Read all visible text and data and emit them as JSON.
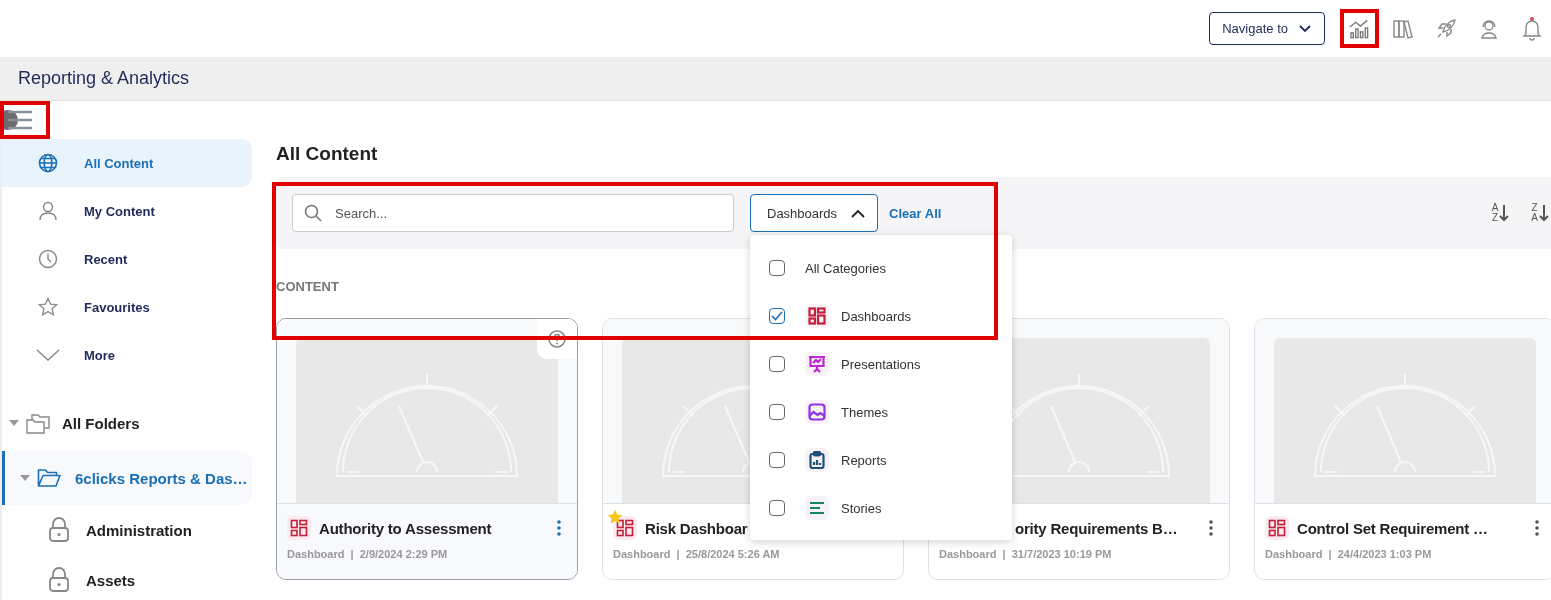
{
  "header": {
    "navigate_button": "Navigate to",
    "icons": [
      {
        "kind": "analytics",
        "selected": true
      },
      {
        "kind": "library",
        "selected": false
      },
      {
        "kind": "rocket",
        "selected": false
      },
      {
        "kind": "support",
        "selected": false
      },
      {
        "kind": "bell",
        "selected": false
      }
    ]
  },
  "page_title": "Reporting & Analytics",
  "sidebar": {
    "items": [
      {
        "label": "All Content",
        "kind": "globe",
        "selected": true
      },
      {
        "label": "My Content",
        "kind": "person",
        "selected": false
      },
      {
        "label": "Recent",
        "kind": "clock",
        "selected": false
      },
      {
        "label": "Favourites",
        "kind": "star",
        "selected": false
      },
      {
        "label": "More",
        "kind": "chevron",
        "selected": false
      }
    ],
    "folders": {
      "label": "All Folders",
      "expanded": true,
      "children": [
        {
          "label": "6clicks Reports & Das…",
          "expanded": true,
          "selected": true,
          "children": [
            {
              "label": "Administration"
            },
            {
              "label": "Assets"
            }
          ]
        }
      ]
    }
  },
  "main": {
    "heading": "All Content",
    "search": {
      "placeholder": "Search..."
    },
    "filter": {
      "label": "Dashboards",
      "open": true
    },
    "clear_all": "Clear All",
    "sort_buttons": [
      {
        "top": "A",
        "bottom": "Z"
      },
      {
        "top": "Z",
        "bottom": "A"
      }
    ],
    "section_label": "CONTENT",
    "cards": [
      {
        "title": "Authority to Assessment",
        "meta": "Dashboard  |  2/9/2024 2:29 PM",
        "favourite": false,
        "hovered": true,
        "icon_visible": true,
        "menu_visible": true
      },
      {
        "title": "Risk Dashboar",
        "meta": "Dashboard  |  25/8/2024 5:26 AM",
        "favourite": true,
        "hovered": false,
        "icon_visible": true,
        "menu_visible": false
      },
      {
        "title": "ority Requirements B…",
        "meta": "Dashboard  |  31/7/2023 10:19 PM",
        "favourite": false,
        "hovered": false,
        "icon_visible": false,
        "menu_visible": true
      },
      {
        "title": "Control Set Requirement …",
        "meta": "Dashboard  |  24/4/2023 1:03 PM",
        "favourite": false,
        "hovered": false,
        "icon_visible": true,
        "menu_visible": true
      }
    ],
    "dropdown_options": [
      {
        "label": "All Categories",
        "checked": false,
        "kind": "none"
      },
      {
        "label": "Dashboards",
        "checked": true,
        "kind": "dashboard",
        "color": "#c41e3a"
      },
      {
        "label": "Presentations",
        "checked": false,
        "kind": "presentation",
        "color": "#c026d3"
      },
      {
        "label": "Themes",
        "checked": false,
        "kind": "image",
        "color": "#9333ea"
      },
      {
        "label": "Reports",
        "checked": false,
        "kind": "clipboard",
        "color": "#1e4f7a"
      },
      {
        "label": "Stories",
        "checked": false,
        "kind": "lines",
        "color": "#11866a"
      }
    ]
  }
}
